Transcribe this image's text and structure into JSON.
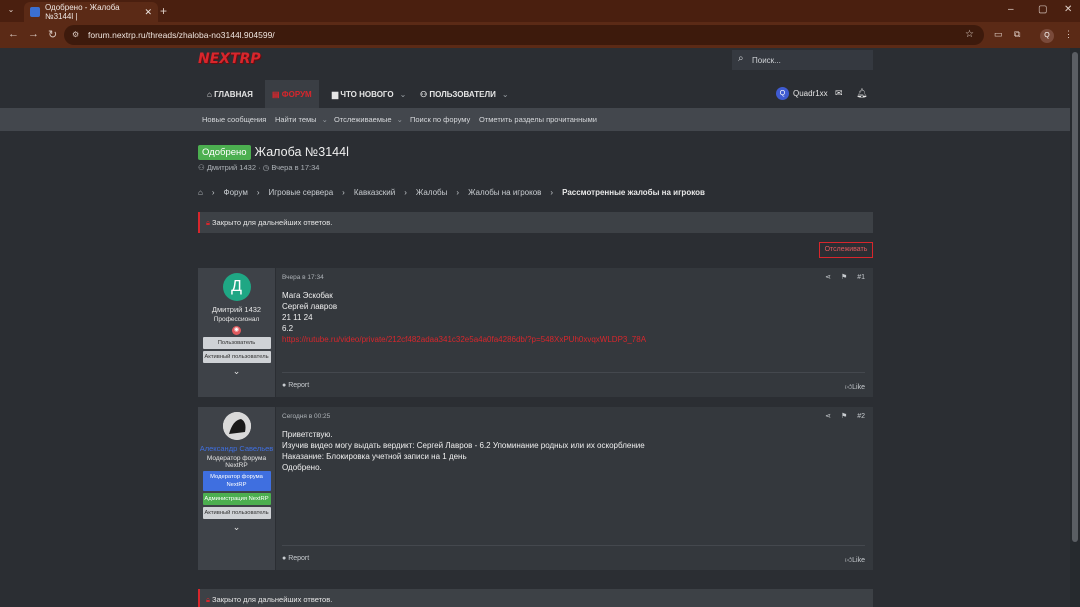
{
  "browser": {
    "tab_title": "Одобрено - Жалоба №3144l |",
    "tab_close": "✕",
    "new_tab": "+",
    "url": "forum.nextrp.ru/threads/zhaloba-no3144l.904599/",
    "window_controls": [
      "–",
      "▢",
      "✕"
    ],
    "profile_initial": "Q"
  },
  "site": {
    "logo": "NEXTRP",
    "search_placeholder": "Поиск...",
    "nav": [
      {
        "label": "ГЛАВНАЯ",
        "icon": "home-icon"
      },
      {
        "label": "ФОРУМ",
        "icon": "forum-icon"
      },
      {
        "label": "ЧТО НОВОГО",
        "icon": "chat-icon"
      },
      {
        "label": "ПОЛЬЗОВАТЕЛИ",
        "icon": "users-icon"
      }
    ],
    "user": {
      "name": "Quadr1xx",
      "initial": "Q"
    },
    "subnav": [
      "Новые сообщения",
      "Найти темы",
      "Отслеживаемые",
      "Поиск по форуму",
      "Отметить разделы прочитанными"
    ]
  },
  "thread": {
    "badge": "Одобрено",
    "title": "Жалоба №3144l",
    "author": "Дмитрий 1432",
    "date": "Вчера в 17:34",
    "breadcrumb": [
      "Форум",
      "Игровые сервера",
      "Кавказский",
      "Жалобы",
      "Жалобы на игроков",
      "Рассмотренные жалобы на игроков"
    ],
    "closed_notice": "Закрыто для дальнейших ответов.",
    "follow_label": "Отслеживать"
  },
  "posts": [
    {
      "author": "Дмитрий 1432",
      "avatar_letter": "Д",
      "avatar_color": "#1fa784",
      "user_title": "Профессионал",
      "banners": [
        "Пользователь",
        "Активный пользователь"
      ],
      "date": "Вчера в 17:34",
      "number": "#1",
      "lines": [
        "Мага Эскобак",
        "Сергей лавров",
        "21 11 24",
        "6.2"
      ],
      "link": "https://rutube.ru/video/private/212cf482adaa341c32e5a4a0fa4286db/?p=548XxPUh0xvqxWLDP3_78A",
      "report": "Report",
      "like": "Like"
    },
    {
      "author": "Александр Савельев",
      "user_title": "Модератор форума NextRP",
      "banners": [
        "Модератор форума NextRP",
        "Администрация NextRP",
        "Активный пользователь"
      ],
      "date": "Сегодня в 00:25",
      "number": "#2",
      "lines": [
        "Приветствую.",
        "Изучив видео могу выдать вердикт: Сергей Лавров - 6.2 Упоминание родных или их оскорбление",
        "Наказание: Блокировка учетной записи на 1 день",
        "Одобрено."
      ],
      "report": "Report",
      "like": "Like"
    }
  ]
}
